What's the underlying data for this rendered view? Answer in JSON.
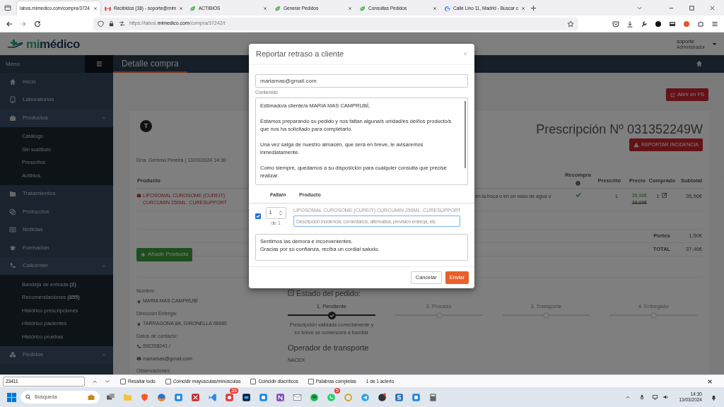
{
  "browser": {
    "tabs": [
      {
        "title": "labos.mimedico.com/compra/3724",
        "selected": true,
        "kind": "page"
      },
      {
        "title": "Recibidos (38) - soporte@mim",
        "selected": false,
        "kind": "mail"
      },
      {
        "title": "ACTIBIOS",
        "selected": false,
        "kind": "site"
      },
      {
        "title": "Generar Pedidos",
        "selected": false,
        "kind": "site"
      },
      {
        "title": "Consultas Pedidos",
        "selected": false,
        "kind": "site"
      },
      {
        "title": "Calle Lino 11, Madrid - Buscar c",
        "selected": false,
        "kind": "search"
      }
    ],
    "url_prefix": "https://labos.",
    "url_domain": "mimedico.com",
    "url_path": "/compra/37242/t"
  },
  "app": {
    "logo_prefix": "mi",
    "logo_suffix": "médico",
    "user": "soporte",
    "role": "Administrador",
    "menu_label": "Menú",
    "page_title": "Detalle compra"
  },
  "sidebar": {
    "items": [
      {
        "label": "Inicio",
        "kind": "home"
      },
      {
        "label": "Laboratorios",
        "kind": "tablet"
      },
      {
        "label": "Productos",
        "kind": "briefcase",
        "expanded": true,
        "children": [
          {
            "label": "Catálogo"
          },
          {
            "label": "Sin sustituto"
          },
          {
            "label": "Prescritos"
          },
          {
            "label": "Actibios"
          }
        ]
      },
      {
        "label": "Tratamientos",
        "kind": "folder"
      },
      {
        "label": "Protocolos",
        "kind": "circles"
      },
      {
        "label": "Noticias",
        "kind": "news"
      },
      {
        "label": "Formación",
        "kind": "cap"
      },
      {
        "label": "Callcenter",
        "kind": "phone",
        "expanded": true,
        "children": [
          {
            "label": "Bandeja de entrada **(2)**"
          },
          {
            "label": "Recomendaciones **(855)**"
          },
          {
            "label": "Histórico prescripciones"
          },
          {
            "label": "Histórico pacientes"
          },
          {
            "label": "Histórico pruebas"
          }
        ]
      },
      {
        "label": "Pedidos",
        "kind": "boxes",
        "expanded": true
      }
    ]
  },
  "purchase": {
    "open_button": "Abrir en FS",
    "avatar": "T",
    "title": "Prescripción Nº 031352249W",
    "report_button": "REPORTAR INCIDENCIA",
    "doctor": "Dr/a. Gemma Pereira | 13/03/2024 14:30",
    "table": {
      "columns": [
        "Producto",
        "Recompra",
        "Prescrito",
        "Precio",
        "Comprado",
        "Subtotal"
      ],
      "rows": [
        {
          "product": "LIPOSOMAL CUROSOME (CUREIT) CURCUMIN 250ML. CURESUPPORT",
          "dosage": "en la boca o en un vaso de agua o",
          "rebuy": true,
          "prescribed": "1",
          "price": "35,96€",
          "old_price": "38,95€",
          "bought": "1",
          "subtotal": "35,96€"
        }
      ],
      "totals": [
        {
          "label": "Portes",
          "value": "1,50€"
        },
        {
          "label": "TOTAL",
          "value": "37,46€"
        }
      ]
    },
    "add_button": "Añadir Producto"
  },
  "customer": {
    "fields": [
      {
        "label": "Nombre:",
        "lines": [
          {
            "kind": "pin",
            "text": "MARIA MAS CAMPRUBÍ"
          }
        ]
      },
      {
        "label": "Dirección Entrega:",
        "lines": [
          {
            "kind": "pin",
            "text": "TARRAGONA 8A, GIRONELLA 08680"
          }
        ]
      },
      {
        "label": "Datos de contacto:",
        "lines": [
          {
            "kind": "phone",
            "text": "692208241 /"
          },
          {
            "kind": "mail",
            "text": "mariamas@gmail.com"
          }
        ]
      },
      {
        "label": "Observaciones:"
      }
    ]
  },
  "order_status": {
    "title": "Estado del pedido:",
    "steps": [
      {
        "label": "1. Pendiente",
        "active": true,
        "description": "Prescripción validada correctamente y en breve se comenzará a tramitar"
      },
      {
        "label": "2. Proceso",
        "active": false
      },
      {
        "label": "3. Transporte",
        "active": false
      },
      {
        "label": "4. Entregado",
        "active": false
      }
    ],
    "carrier_title": "Operador de transporte",
    "carrier": "NACEX"
  },
  "modal": {
    "title": "Reportar retraso a cliente",
    "close": "×",
    "email": "mariamas@gmail.com",
    "content_label": "Contenido",
    "message": [
      "Estimado/a cliente/a MARIA MAS CAMPRUBÍ,",
      "Estamos preparando su pedido y nos faltan alguna/s unidad/es del/los producto/s que nos ha solicitado para completarlo.",
      "Una vez salga de nuestro almacén, que será en breve, le avisaremos inmediatamente.",
      "Como siempre, quedamos a su disposición para cualquier consulta que precise realizar."
    ],
    "columns": [
      "Falta/n",
      "Producto"
    ],
    "items": [
      {
        "checked": true,
        "missing": "1",
        "of": "de 1",
        "product": "LIPOSOMAL CUROSOME (CUREIT) CURCUMIN 250ML. CURESUPPORT",
        "placeholder": "Descripción incidencia, comentarios, alternativa, previsión entrega, etc."
      }
    ],
    "closing": [
      "Sentimos las demora e inconvenientes.",
      "Gracias por su confianza, reciba un cordial saludo."
    ],
    "cancel": "Cancelar",
    "send": "Enviar"
  },
  "find_bar": {
    "query": "23411",
    "options": [
      {
        "label": "Resaltar todo",
        "checked": false
      },
      {
        "label": "Coincidir mayúsculas/minúsculas",
        "checked": false
      },
      {
        "label": "Coincidir diacríticos",
        "checked": false
      },
      {
        "label": "Palabras completas",
        "checked": false
      }
    ],
    "result": "1 de 1 acierto"
  },
  "taskbar": {
    "search_placeholder": "Búsqueda",
    "apps": [
      {
        "kind": "tasks"
      },
      {
        "kind": "folder"
      },
      {
        "kind": "shield"
      },
      {
        "kind": "fox"
      },
      {
        "kind": "blue"
      },
      {
        "kind": "red"
      },
      {
        "kind": "code"
      },
      {
        "kind": "chat",
        "badge": "33"
      },
      {
        "kind": "ps"
      },
      {
        "kind": "blue"
      },
      {
        "kind": "note"
      },
      {
        "kind": "mail"
      },
      {
        "kind": "music"
      },
      {
        "kind": "phone",
        "badge": "5"
      },
      {
        "kind": "ring"
      },
      {
        "kind": "plane"
      },
      {
        "kind": "record"
      },
      {
        "kind": "store"
      },
      {
        "kind": "blue"
      },
      {
        "kind": "calc"
      }
    ],
    "time": "14:30",
    "date": "13/03/2024"
  }
}
